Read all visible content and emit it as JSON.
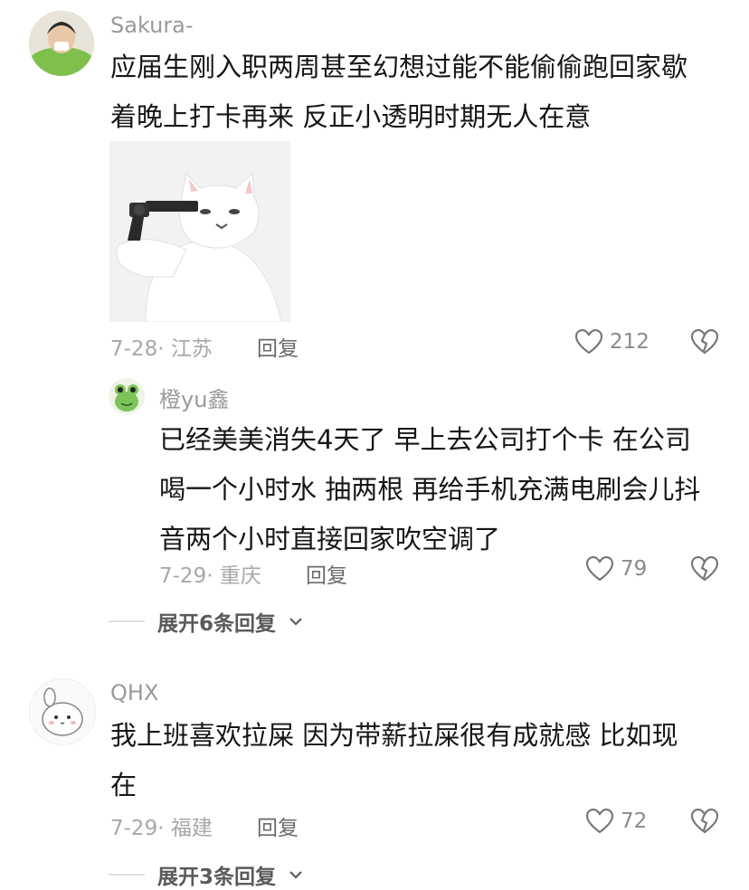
{
  "comments": [
    {
      "username": "Sakura-",
      "text_lines": [
        "应届生刚入职两周甚至幻想过能不能偷偷跑回家歇",
        "着晚上打卡再来 反正小透明时期无人在意"
      ],
      "meta": "7-28· 江苏",
      "reply_label": "回复",
      "likes": "212",
      "avatar_icon": "avatar-photo",
      "image_icon": "cat-with-gun-sticker",
      "reply": {
        "username": "橙yu鑫",
        "text_lines": [
          "已经美美消失4天了 早上去公司打个卡 在公司",
          "喝一个小时水 抽两根 再给手机充满电刷会儿抖",
          "音两个小时直接回家吹空调了"
        ],
        "meta": "7-29· 重庆",
        "reply_label": "回复",
        "likes": "79",
        "avatar_icon": "green-frog-avatar"
      },
      "expand_label": "展开6条回复"
    },
    {
      "username": "QHX",
      "text_lines": [
        "我上班喜欢拉屎 因为带薪拉屎很有成就感 比如现",
        "在"
      ],
      "meta": "7-29· 福建",
      "reply_label": "回复",
      "likes": "72",
      "avatar_icon": "cartoon-bunny-avatar",
      "expand_label": "展开3条回复"
    }
  ]
}
